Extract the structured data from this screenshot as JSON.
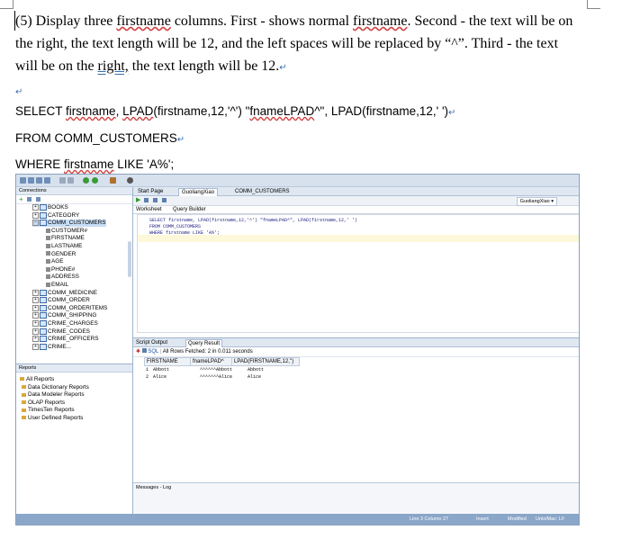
{
  "question": {
    "text_before_w1": "(5) Display three ",
    "w1": "firstname",
    "text_mid1": " columns. First - shows normal ",
    "w2": "firstname",
    "text_mid2": ". Second - the text will be on the right, the text length will be 12, and the left spaces will be replaced by “^”. Third - the text will be on the ",
    "w3": "right,",
    "text_end": " the text length will be 12."
  },
  "sql": {
    "line1_a": "SELECT ",
    "line1_w1": "firstname",
    "line1_b": ", ",
    "line1_w2": "LPAD",
    "line1_c": "(firstname,12,'^') \"",
    "line1_w3": "fnameLPAD",
    "line1_d": "^\", LPAD(firstname,12,' ')",
    "line2": "FROM COMM_CUSTOMERS",
    "line3_a": "WHERE ",
    "line3_w": "firstname",
    "line3_b": " LIKE 'A%';"
  },
  "ide": {
    "connections_label": "Connections",
    "reports_label": "Reports",
    "tree": [
      "BOOKS",
      "CATEGORY",
      "COMM_CUSTOMERS",
      "CUSTOMER#",
      "FIRSTNAME",
      "LASTNAME",
      "GENDER",
      "AGE",
      "PHONE#",
      "ADDRESS",
      "EMAIL",
      "COMM_MEDICINE",
      "COMM_ORDER",
      "COMM_ORDERITEMS",
      "COMM_SHIPPING",
      "CRIME_CHARGES",
      "CRIME_CODES",
      "CRIME_OFFICERS",
      "CRIME..."
    ],
    "report_items": [
      "All Reports",
      "Data Dictionary Reports",
      "Data Modeler Reports",
      "OLAP Reports",
      "TimesTen Reports",
      "User Defined Reports"
    ],
    "tabs": [
      "Start Page",
      "GuoliangXiao",
      "COMM_CUSTOMERS"
    ],
    "connection_name": "GuoliangXiao",
    "subtabs": [
      "Worksheet",
      "Query Builder"
    ],
    "code": [
      "SELECT firstname, LPAD(firstname,12,'^') \"fnameLPAD^\", LPAD(firstname,12,' ')",
      "FROM COMM_CUSTOMERS",
      "WHERE firstname LIKE 'A%';"
    ],
    "result_tabs": [
      "Script Output",
      "Query Result"
    ],
    "fetch_info": "All Rows Fetched: 2 in 0.011 seconds",
    "sql_label": "SQL",
    "columns": [
      "FIRSTNAME",
      "fnameLPAD^",
      "LPAD(FIRSTNAME,12,'')"
    ],
    "rows": [
      [
        "1",
        "Abbott",
        "^^^^^^Abbott",
        "Abbott"
      ],
      [
        "2",
        "Alice",
        "^^^^^^^Alice",
        "Alice"
      ]
    ],
    "messages_label": "Messages - Log",
    "status": [
      "Line 3 Column 27",
      "Insert",
      "Modified",
      "Unix/Mac: LF"
    ]
  },
  "colors": {
    "ide_frame": "#8aa2c0",
    "status_bar": "#8aa6c8",
    "squiggle": "#d04040"
  }
}
